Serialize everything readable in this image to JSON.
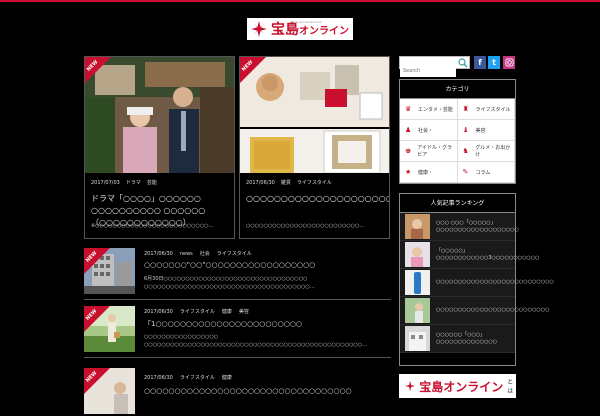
{
  "header": {
    "logo_text": "宝島",
    "logo_text2": "オンライン",
    "logo_tagline": "takarajimashaonline"
  },
  "badge": "NEW",
  "featured": [
    {
      "date": "2017/07/03",
      "tags": [
        "ドラマ",
        "芸能"
      ],
      "title": "ドラマ「○○○○」○○○○○○ ○○○○○○○○○○ ○○○○○○（○○○○○○○○○○○○）",
      "desc": "※○○○○○○○○○○○○○○○○○○○○○○○○○○..."
    },
    {
      "date": "2017/06/30",
      "tags": [
        "雑貨",
        "ライフスタイル"
      ],
      "title": "○○○○○○○○○○○○○○○○○○○○○○○○○○○○○○○○○○○○",
      "desc": "○○○○○○○○○○○○○○○○○○○○○○○○○○..."
    }
  ],
  "list": [
    {
      "date": "2017/06/30",
      "tags": [
        "news",
        "社会",
        "ライフスタイル"
      ],
      "title": "○○○○○○○\"○○\"○○○○○○○○○○○○○○○○○○",
      "desc": "6月30日○○○○○○○○○○○○○○○○○○○○○○○○○○○○○○○○○ ○○○○○○○○○○○○○○○○○○○○○○○○○○○○○○○○○○○○○○..."
    },
    {
      "date": "2017/06/30",
      "tags": [
        "ライフスタイル",
        "健康",
        "美容"
      ],
      "title": "「1○○○○○○○○○○○○○○○○○○○○○○○○",
      "desc": "○○○○○○○○○○○○○○○○○ ○○○○○○○○○○○○○○○○○○○○○○○○○○○○○○○○○○○○○○○○○○○○○○○○○○..."
    },
    {
      "date": "2017/06/30",
      "tags": [
        "ライフスタイル",
        "健康"
      ],
      "title": "○○○○○○○○○○○○○○○○○○○○○○○○○○○○○○○○○○",
      "desc": ""
    }
  ],
  "sidebar": {
    "search_placeholder": "Search",
    "social": [
      "f",
      "t",
      "i"
    ],
    "category_head": "カテゴリ",
    "categories": [
      "エンタメ・芸能",
      "ライフスタイル",
      "社会・",
      "美容",
      "アイドル・グラビア",
      "グルメ・お出かけ",
      "健康・",
      "コラム"
    ],
    "ranking_head": "人気記事ランキング",
    "ranking": [
      "○○○ ○○○「○○○○○」○○○○○○○○○○○○○○○○○○○",
      "「○○○○○」○○○○○○○○○○○○3○○○○○○○○○○○",
      "○○○○○○○○○○○○○○○○○○○○○○○○○○○",
      "○○○○○○○○○○○○○○○○○○○○○○○○○○",
      "○○○○○○「○○○」○○○○○○○○○○○○○○"
    ],
    "about_brand": "宝島オンライン",
    "about_suffix": "とは"
  },
  "colors": {
    "accent": "#c8102e",
    "background": "#000000",
    "facebook": "#3b5998",
    "twitter": "#1da1f2",
    "instagram": "#c13584"
  }
}
